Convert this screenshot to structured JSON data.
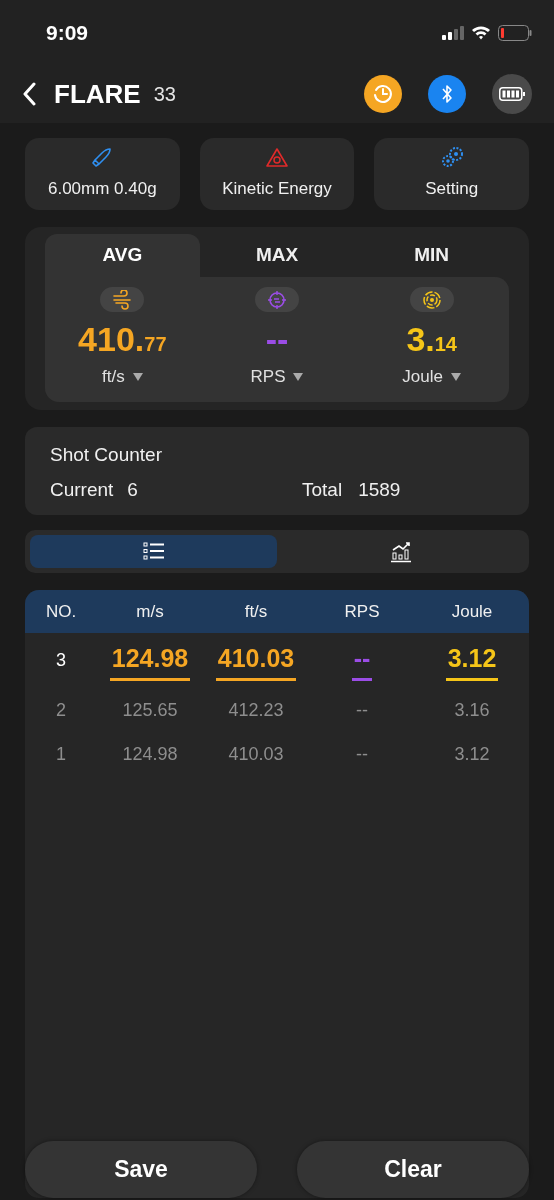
{
  "status_bar": {
    "time": "9:09"
  },
  "header": {
    "title": "FLARE",
    "count": "33"
  },
  "quick_buttons": [
    {
      "kind": "bullet",
      "label": "6.00mm 0.40g"
    },
    {
      "kind": "energy",
      "label": "Kinetic Energy"
    },
    {
      "kind": "gears",
      "label": "Setting"
    }
  ],
  "stat_tabs": [
    {
      "label": "AVG",
      "selected": true
    },
    {
      "label": "MAX",
      "selected": false
    },
    {
      "label": "MIN",
      "selected": false
    }
  ],
  "stats": [
    {
      "kind": "wind",
      "color": "#f5a623",
      "integer": "410.",
      "decimal": "77",
      "unit": "ft/s"
    },
    {
      "kind": "crosshair",
      "color": "#9b4de6",
      "integer": "--",
      "unit": "RPS"
    },
    {
      "kind": "rings",
      "color": "#f5c518",
      "integer": "3.",
      "decimal": "14",
      "unit": "Joule"
    }
  ],
  "shot_counter": {
    "title": "Shot Counter",
    "current_label": "Current",
    "current": "6",
    "total_label": "Total",
    "total": "1589"
  },
  "view_toggle": [
    {
      "kind": "list",
      "selected": true
    },
    {
      "kind": "chart",
      "selected": false
    }
  ],
  "table": {
    "columns": [
      {
        "label": "NO."
      },
      {
        "label": "m/s",
        "color": "#f5a623"
      },
      {
        "label": "ft/s",
        "color": "#f5a623"
      },
      {
        "label": "RPS",
        "color": "#9b4de6"
      },
      {
        "label": "Joule",
        "color": "#f5c518"
      }
    ],
    "rows": [
      {
        "highlighted": true,
        "cells": [
          "3",
          "124.98",
          "410.03",
          "--",
          "3.12"
        ]
      },
      {
        "highlighted": false,
        "cells": [
          "2",
          "125.65",
          "412.23",
          "--",
          "3.16"
        ]
      },
      {
        "highlighted": false,
        "cells": [
          "1",
          "124.98",
          "410.03",
          "--",
          "3.12"
        ]
      }
    ]
  },
  "actions": [
    "Save",
    "Clear"
  ]
}
